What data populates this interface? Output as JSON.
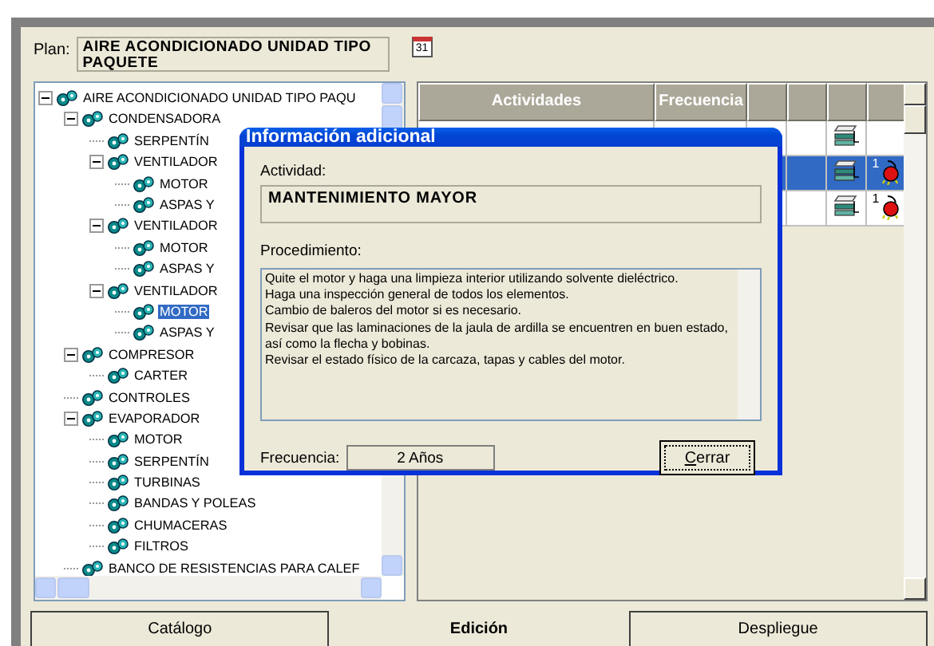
{
  "plan": {
    "label": "Plan:",
    "value": "AIRE ACONDICIONADO UNIDAD TIPO PAQUETE",
    "calendar_button": "31"
  },
  "tree": [
    {
      "label": "AIRE ACONDICIONADO UNIDAD TIPO PAQU",
      "expanded": true,
      "selected": false,
      "children": [
        {
          "label": "CONDENSADORA",
          "expanded": true,
          "selected": false,
          "children": [
            {
              "label": "SERPENTÍN",
              "selected": false
            },
            {
              "label": "VENTILADOR",
              "expanded": true,
              "selected": false,
              "children": [
                {
                  "label": "MOTOR",
                  "selected": false
                },
                {
                  "label": "ASPAS Y",
                  "selected": false
                }
              ]
            },
            {
              "label": "VENTILADOR",
              "expanded": true,
              "selected": false,
              "children": [
                {
                  "label": "MOTOR",
                  "selected": false
                },
                {
                  "label": "ASPAS Y",
                  "selected": false
                }
              ]
            },
            {
              "label": "VENTILADOR",
              "expanded": true,
              "selected": false,
              "children": [
                {
                  "label": "MOTOR",
                  "selected": true
                },
                {
                  "label": "ASPAS Y",
                  "selected": false
                }
              ]
            }
          ]
        },
        {
          "label": "COMPRESOR",
          "expanded": true,
          "selected": false,
          "children": [
            {
              "label": "CARTER",
              "selected": false
            }
          ]
        },
        {
          "label": "CONTROLES",
          "selected": false
        },
        {
          "label": "EVAPORADOR",
          "expanded": true,
          "selected": false,
          "children": [
            {
              "label": "MOTOR",
              "selected": false
            },
            {
              "label": "SERPENTÍN",
              "selected": false
            },
            {
              "label": "TURBINAS",
              "selected": false
            },
            {
              "label": "BANDAS Y POLEAS",
              "selected": false
            },
            {
              "label": "CHUMACERAS",
              "selected": false
            },
            {
              "label": "FILTROS",
              "selected": false
            }
          ]
        },
        {
          "label": "BANCO DE RESISTENCIAS PARA CALEF",
          "selected": false
        }
      ]
    }
  ],
  "table": {
    "columns": [
      "Actividades",
      "Frecuencia"
    ],
    "rows": [
      {
        "selected": false,
        "alert": false
      },
      {
        "selected": true,
        "alert": true,
        "count": "1"
      },
      {
        "selected": false,
        "alert": true,
        "count": "1"
      }
    ]
  },
  "dialog": {
    "title": "Información adicional",
    "activity_label": "Actividad:",
    "activity": "MANTENIMIENTO MAYOR",
    "procedure_label": "Procedimiento:",
    "procedure": "Quite el motor y haga una limpieza interior utilizando solvente dieléctrico.\nHaga una inspección general de todos los elementos.\nCambio de baleros del motor si es necesario.\nRevisar que las laminaciones de la jaula de ardilla se encuentren en buen estado,\nasí como la flecha y bobinas.\nRevisar el estado físico de la carcaza, tapas y cables del motor.",
    "frequency_label": "Frecuencia:",
    "frequency": "2 Años",
    "close_button": "Cerrar"
  },
  "tabs": [
    {
      "label": "Catálogo",
      "selected": false
    },
    {
      "label": "Edición",
      "selected": true
    },
    {
      "label": "Despliegue",
      "selected": false
    }
  ]
}
